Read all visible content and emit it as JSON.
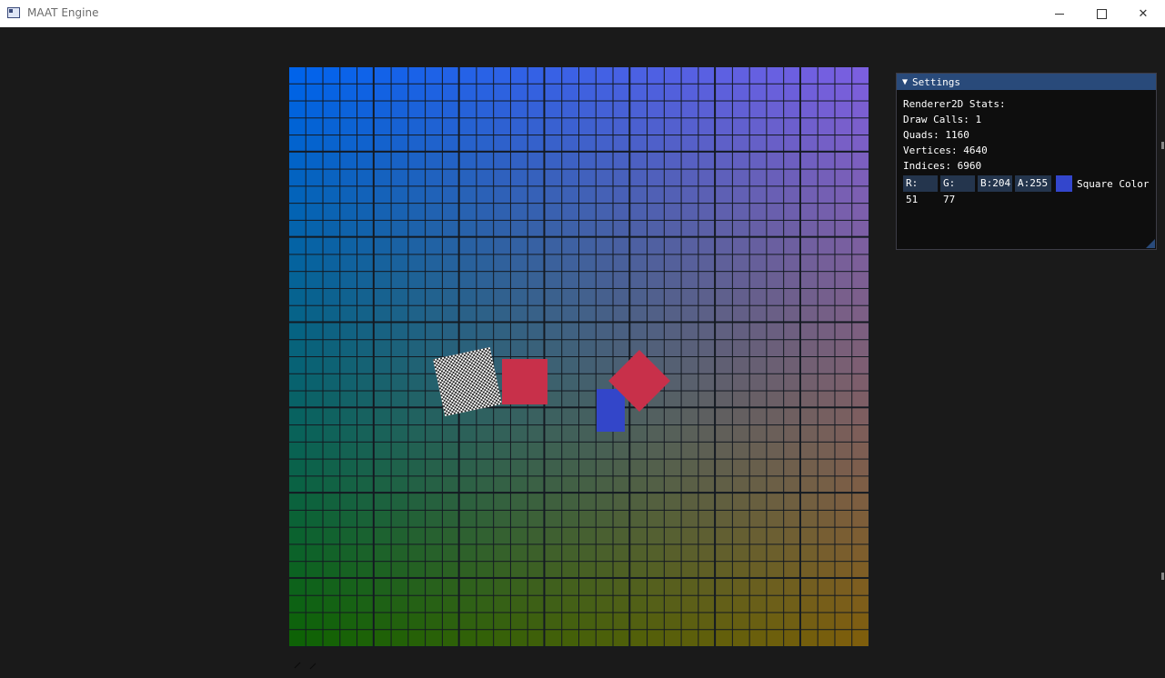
{
  "window": {
    "title": "MAAT Engine"
  },
  "titlebar_buttons": {
    "minimize": "minimize-icon",
    "maximize": "maximize-icon",
    "close": "close-icon",
    "close_glyph": "✕"
  },
  "scene": {
    "grid_columns": 34,
    "grid_rows": 34,
    "colors": {
      "top_left": "#0063ea",
      "top_right": "#7b5fdf",
      "bottom_left": "#0e6206",
      "bottom_right": "#7e5e0d",
      "grid_line": "#141a22",
      "red_quad": "#c8304a",
      "blue_quad": "#3346c9"
    }
  },
  "settings": {
    "title": "Settings",
    "stats_header": "Renderer2D Stats:",
    "draw_calls": "Draw Calls: 1",
    "quads": "Quads: 1160",
    "vertices": "Vertices: 4640",
    "indices": "Indices: 6960",
    "color_r": "R: 51",
    "color_g": "G: 77",
    "color_b": "B:204",
    "color_a": "A:255",
    "color_label": "Square Color",
    "square_color": "#3346cc"
  }
}
